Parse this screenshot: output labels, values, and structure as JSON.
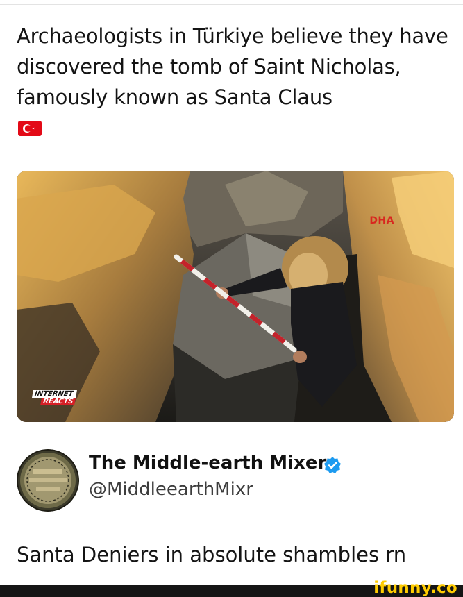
{
  "post": {
    "headline": "Archaeologists in Türkiye believe they have discovered the tomb of Saint Nicholas, famously known as Santa Claus",
    "flag_icon": "turkey-flag-icon"
  },
  "media": {
    "watermark": "DHA",
    "badge_line1": "INTERNET",
    "badge_line2": "REACTS"
  },
  "account": {
    "name": "The Middle-earth Mixer",
    "handle": "@MiddleearthMixr",
    "verified_icon": "verified-badge-icon",
    "verified_color": "#1d9bf0"
  },
  "tweet": {
    "text": "Santa Deniers in absolute shambles rn"
  },
  "footer": {
    "brand": "ifunny.co",
    "brand_color": "#ffcc00"
  }
}
